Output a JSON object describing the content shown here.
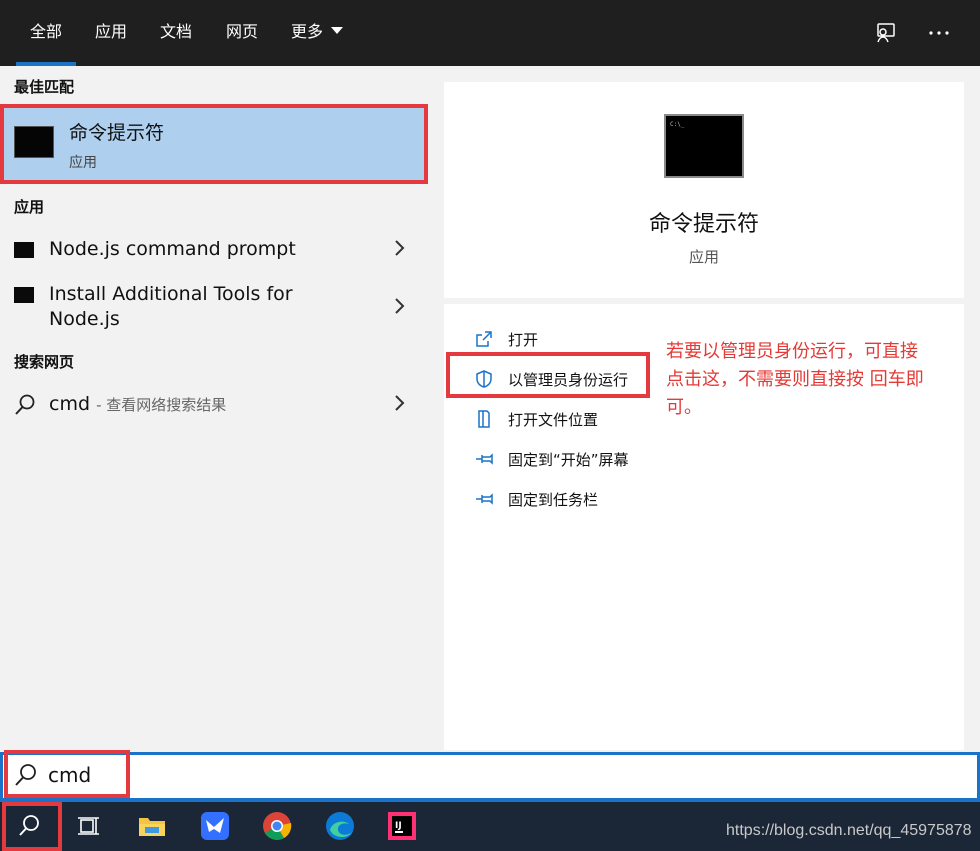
{
  "tabs": [
    {
      "label": "全部",
      "active": true
    },
    {
      "label": "应用"
    },
    {
      "label": "文档"
    },
    {
      "label": "网页"
    },
    {
      "label": "更多"
    }
  ],
  "left": {
    "best_match_header": "最佳匹配",
    "best_match": {
      "title": "命令提示符",
      "subtitle": "应用",
      "icon": "cmd-icon"
    },
    "apps_header": "应用",
    "apps": [
      {
        "label": "Node.js command prompt"
      },
      {
        "label_line1": "Install Additional Tools for",
        "label_line2": "Node.js"
      }
    ],
    "web_header": "搜索网页",
    "web_result": {
      "query": "cmd",
      "hint": "- 查看网络搜索结果"
    }
  },
  "detail": {
    "title": "命令提示符",
    "subtitle": "应用",
    "actions": [
      {
        "label": "打开",
        "icon": "open-icon"
      },
      {
        "label": "以管理员身份运行",
        "icon": "shield-icon"
      },
      {
        "label": "打开文件位置",
        "icon": "folder-location-icon"
      },
      {
        "label": "固定到“开始”屏幕",
        "icon": "pin-icon"
      },
      {
        "label": "固定到任务栏",
        "icon": "pin-icon"
      }
    ]
  },
  "annotation": {
    "line1": "若要以管理员身份运行，可直接",
    "line2": "点击这，不需要则直接按 回车即",
    "line3": "可。"
  },
  "search": {
    "value": "cmd"
  },
  "taskbar": {
    "items": [
      "search-icon",
      "task-view-icon",
      "file-explorer-icon",
      "feishu-icon",
      "chrome-icon",
      "edge-icon",
      "intellij-icon"
    ]
  },
  "watermark": "https://blog.csdn.net/qq_45975878",
  "colors": {
    "accent": "#1a73c8",
    "highlight": "#e53940",
    "selection": "#aed0ee",
    "annotation": "#e53935"
  }
}
